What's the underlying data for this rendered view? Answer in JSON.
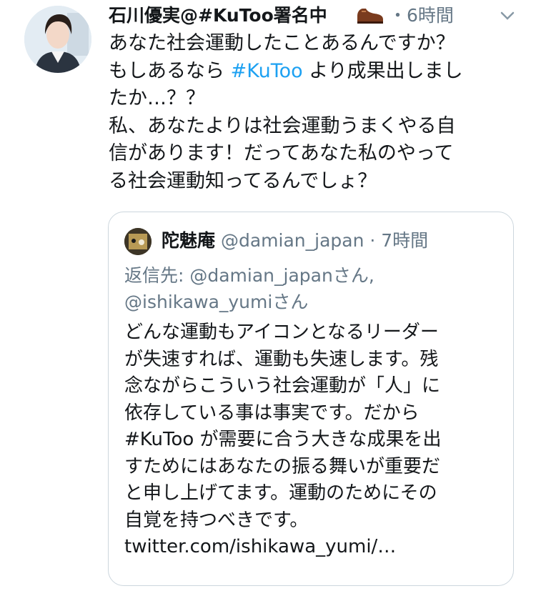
{
  "tweet": {
    "author": "石川優実@#KuToo署名中",
    "time_sep": "・",
    "time": "6時間",
    "lines": [
      [
        "あなた社会運動したことあるんですか？"
      ],
      [
        "もしあるなら ",
        "#KuToo",
        " より成果出しまし"
      ],
      [
        "たか…？？"
      ],
      [
        "私、あなたよりは社会運動うまくやる自"
      ],
      [
        "信があります！だってあなた私のやって"
      ],
      [
        "る社会運動知ってるんでしょ？"
      ]
    ],
    "hashtag": "#KuToo",
    "line2_pre": "もしあるなら ",
    "line2_post": " より成果出しまし"
  },
  "quote": {
    "name": "陀魅庵",
    "handle": "@damian_japan",
    "time": "· 7時間",
    "reply_line1": "返信先: @damian_japanさん,",
    "reply_line2": "@ishikawa_yumiさん",
    "body_lines": [
      "どんな運動もアイコンとなるリーダー",
      "が失速すれば、運動も失速します。残",
      "念ながらこういう社会運動が「人」に",
      "依存している事は事実です。だから",
      "#KuToo が需要に合う大きな成果を出",
      "すためにはあなたの振る舞いが重要だ",
      "と申し上げてます。運動のためにその",
      "自覚を持つべきです。",
      "twitter.com/ishikawa_yumi/…"
    ]
  },
  "icons": {
    "menu": "chevron-down-icon",
    "emoji": "shoe-icon"
  },
  "colors": {
    "link": "#1da1f2",
    "secondary": "#657786",
    "border": "#ccd6dd"
  }
}
